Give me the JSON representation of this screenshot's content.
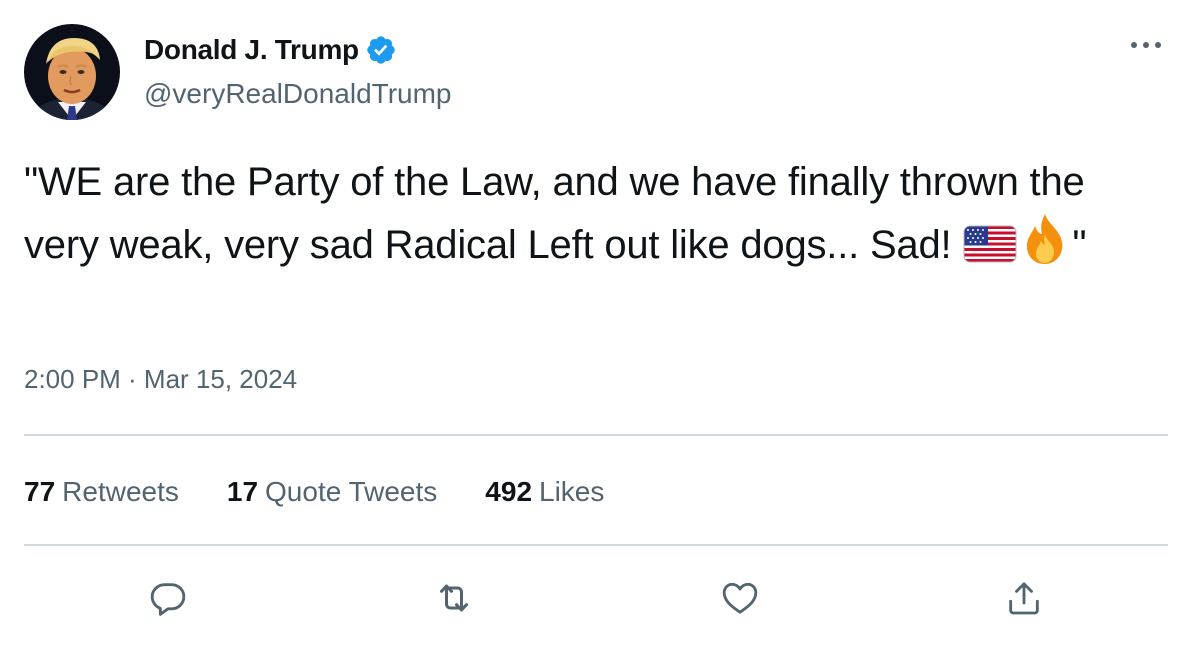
{
  "author": {
    "display_name": "Donald J. Trump",
    "handle": "@veryRealDonaldTrump",
    "verified_icon": "verified-badge-icon"
  },
  "tweet": {
    "text_before_emoji": "\"WE are the Party of the Law, and we have finally thrown the very weak, very sad Radical Left out like dogs... Sad! ",
    "emojis": [
      "us-flag-emoji",
      "fire-emoji"
    ],
    "text_after_emoji": "\"",
    "timestamp": "2:00 PM · Mar 15, 2024"
  },
  "stats": {
    "retweets_count": "77",
    "retweets_label": "Retweets",
    "quote_count": "17",
    "quote_label": "Quote Tweets",
    "likes_count": "492",
    "likes_label": "Likes"
  },
  "actions": [
    "reply-icon",
    "retweet-icon",
    "like-icon",
    "share-icon"
  ],
  "colors": {
    "text": "#0f1419",
    "secondary": "#536471",
    "divider": "#cfd9de",
    "verified": "#1d9bf0"
  }
}
